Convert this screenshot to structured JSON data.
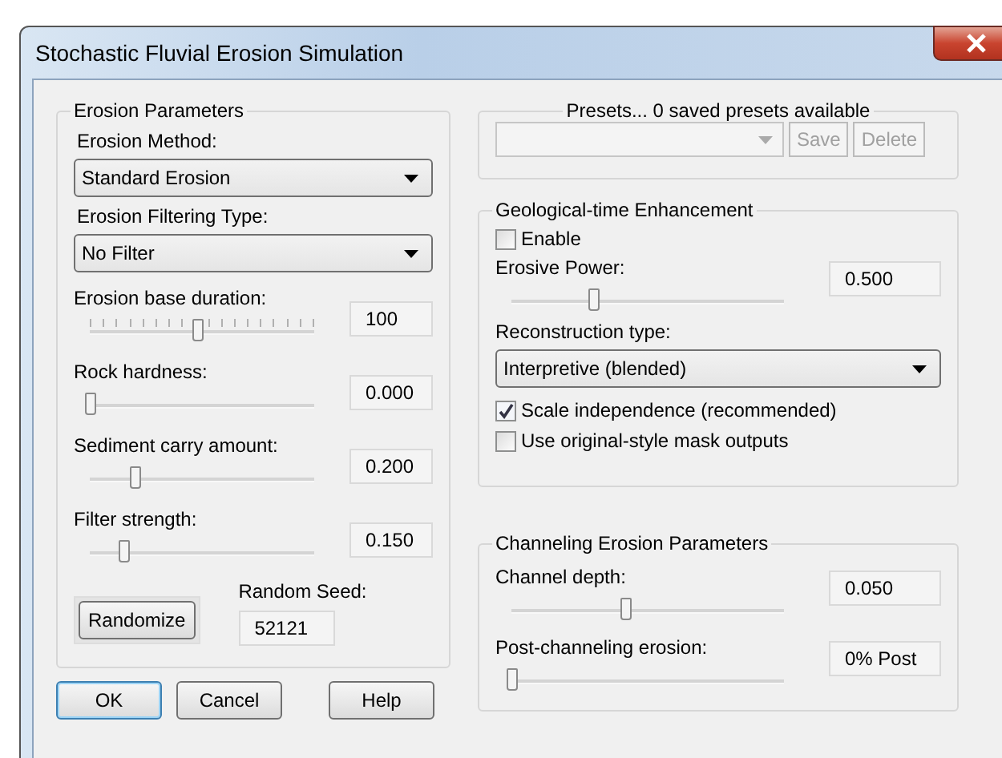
{
  "window": {
    "title": "Stochastic Fluvial Erosion Simulation"
  },
  "erosion_parameters": {
    "title": "Erosion Parameters",
    "dropdowns": [
      {
        "label": "Erosion Method:",
        "value": "Standard Erosion"
      },
      {
        "label": "Erosion Filtering Type:",
        "value": "No Filter"
      }
    ],
    "sliders": [
      {
        "label": "Erosion base duration:",
        "ticks": true,
        "level": 0.48,
        "reading": "100"
      },
      {
        "label": "Rock hardness:",
        "ticks": false,
        "level": 0,
        "reading": "0.000"
      },
      {
        "label": "Sediment carry amount:",
        "ticks": false,
        "level": 0.2,
        "reading": "0.200"
      },
      {
        "label": "Filter strength:",
        "ticks": false,
        "level": 0.15,
        "reading": "0.150"
      }
    ],
    "randomize": "Randomize",
    "seed_label": "Random Seed:",
    "seed": "52121"
  },
  "presets": {
    "title": "Presets... 0 saved presets available",
    "disabled": true,
    "buttons": [
      {
        "label": "Save",
        "disabled": true
      },
      {
        "label": "Delete",
        "disabled": true
      }
    ]
  },
  "geological_time": {
    "title": "Geological-time Enhancement",
    "enable": {
      "label": "Enable",
      "checked": false
    },
    "slider": {
      "label": "Erosive Power:",
      "ticks": false,
      "level": 0.3,
      "reading": "0.500"
    },
    "reconstruction_label": "Reconstruction type:",
    "reconstruction_value": "Interpretive (blended)",
    "options": [
      {
        "label": "Scale independence (recommended)",
        "checked": true
      },
      {
        "label": "Use original-style mask outputs",
        "checked": false
      }
    ]
  },
  "channeling": {
    "title": "Channeling Erosion Parameters",
    "sliders": [
      {
        "label": "Channel depth:",
        "ticks": false,
        "level": 0.42,
        "reading": "0.050"
      },
      {
        "label": "Post-channeling erosion:",
        "ticks": false,
        "level": 0,
        "reading": "0% Post"
      }
    ]
  },
  "buttons": [
    {
      "label": "OK",
      "default": true
    },
    {
      "label": "Cancel",
      "default": false
    },
    {
      "label": "Help",
      "default": false
    }
  ]
}
